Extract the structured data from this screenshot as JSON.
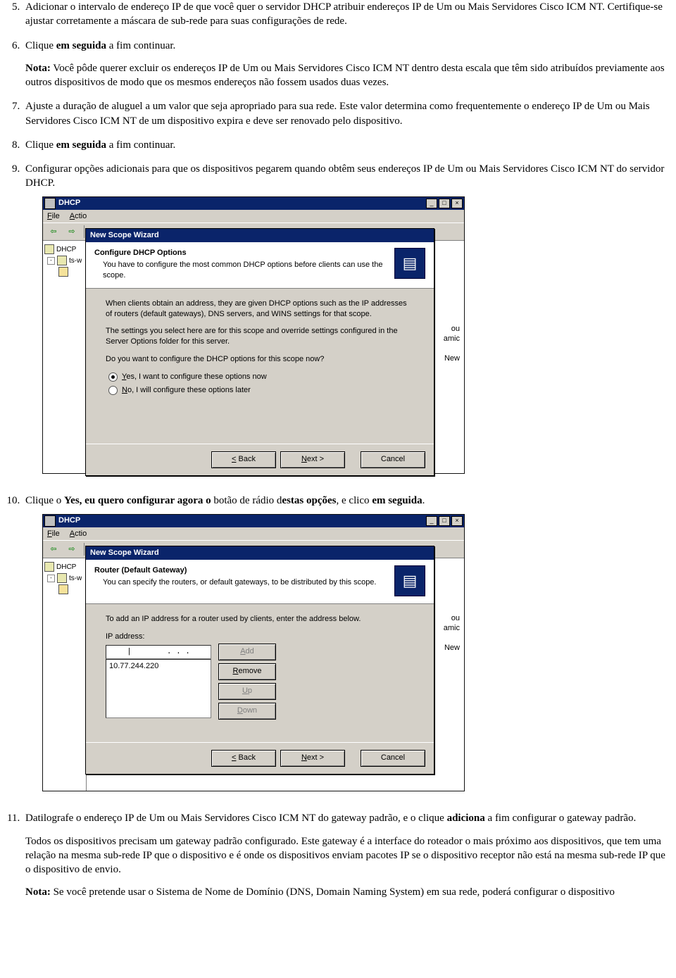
{
  "steps": {
    "s5_p1": "Adicionar o intervalo de endereço IP de que você quer o servidor DHCP atribuir endereços IP de Um ou Mais Servidores Cisco ICM NT. Certifique-se ajustar corretamente a máscara de sub-rede para suas configurações de rede.",
    "s6_p1_a": "Clique ",
    "s6_p1_b": "em seguida",
    "s6_p1_c": " a fim continuar.",
    "s6_note_a": "Nota:",
    "s6_note_b": " Você pôde querer excluir os endereços IP de Um ou Mais Servidores Cisco ICM NT dentro desta escala que têm sido atribuídos previamente aos outros dispositivos de modo que os mesmos endereços não fossem usados duas vezes.",
    "s7_p1": "Ajuste a duração de aluguel a um valor que seja apropriado para sua rede. Este valor determina como frequentemente o endereço IP de Um ou Mais Servidores Cisco ICM NT de um dispositivo expira e deve ser renovado pelo dispositivo.",
    "s8_a": "Clique ",
    "s8_b": "em seguida",
    "s8_c": " a fim continuar.",
    "s9": "Configurar opções adicionais para que os dispositivos pegarem quando obtêm seus endereços IP de Um ou Mais Servidores Cisco ICM NT do servidor DHCP.",
    "s10_a": "Clique o ",
    "s10_b": "Yes, eu quero configurar agora o",
    "s10_c": " botão de rádio d",
    "s10_d": "estas opções",
    "s10_e": ", e clico ",
    "s10_f": "em seguida",
    "s10_g": ".",
    "s11_p1_a": "Datilografe o endereço IP de Um ou Mais Servidores Cisco ICM NT do gateway padrão, e o clique ",
    "s11_p1_b": "adiciona",
    "s11_p1_c": " a fim configurar o gateway padrão.",
    "s11_p2": "Todos os dispositivos precisam um gateway padrão configurado. Este gateway é a interface do roteador o mais próximo aos dispositivos, que tem uma relação na mesma sub-rede IP que o dispositivo e é onde os dispositivos enviam pacotes IP se o dispositivo receptor não está na mesma sub-rede IP que o dispositivo de envio.",
    "s11_note_a": "Nota:",
    "s11_note_b": " Se você pretende usar o Sistema de Nome de Domínio (DNS, Domain Naming System) em sua rede, poderá configurar o dispositivo"
  },
  "app": {
    "title": "DHCP",
    "menu": {
      "file": "File",
      "actio": "Actio"
    },
    "toolbar": {
      "back": "⇦",
      "fwd": "⇨"
    },
    "tree": {
      "root": "DHCP",
      "node": "ts-w"
    },
    "rp": {
      "t1": "ou",
      "t2": "amic",
      "t3": "New"
    }
  },
  "wiz1": {
    "title": "New Scope Wizard",
    "h1": "Configure DHCP Options",
    "h2": "You have to configure the most common DHCP options before clients can use the scope.",
    "p1": "When clients obtain an address, they are given DHCP options such as the IP addresses of routers (default gateways), DNS servers, and WINS settings for that scope.",
    "p2": "The settings you select here are for this scope and override settings configured in the Server Options folder for this server.",
    "p3": "Do you want to configure the DHCP options for this scope now?",
    "r1": "Yes, I want to configure these options now",
    "r2": "No, I will configure these options later",
    "back": "< Back",
    "next": "Next >",
    "cancel": "Cancel"
  },
  "wiz2": {
    "title": "New Scope Wizard",
    "h1": "Router (Default Gateway)",
    "h2": "You can specify the routers, or default gateways, to be distributed by this scope.",
    "p1": "To add an IP address for a router used by clients, enter the address below.",
    "ip_label": "IP address:",
    "ip_dots": ". . .",
    "list_item": "10.77.244.220",
    "add": "Add",
    "remove": "Remove",
    "up": "Up",
    "down": "Down",
    "back": "< Back",
    "next": "Next >",
    "cancel": "Cancel"
  }
}
